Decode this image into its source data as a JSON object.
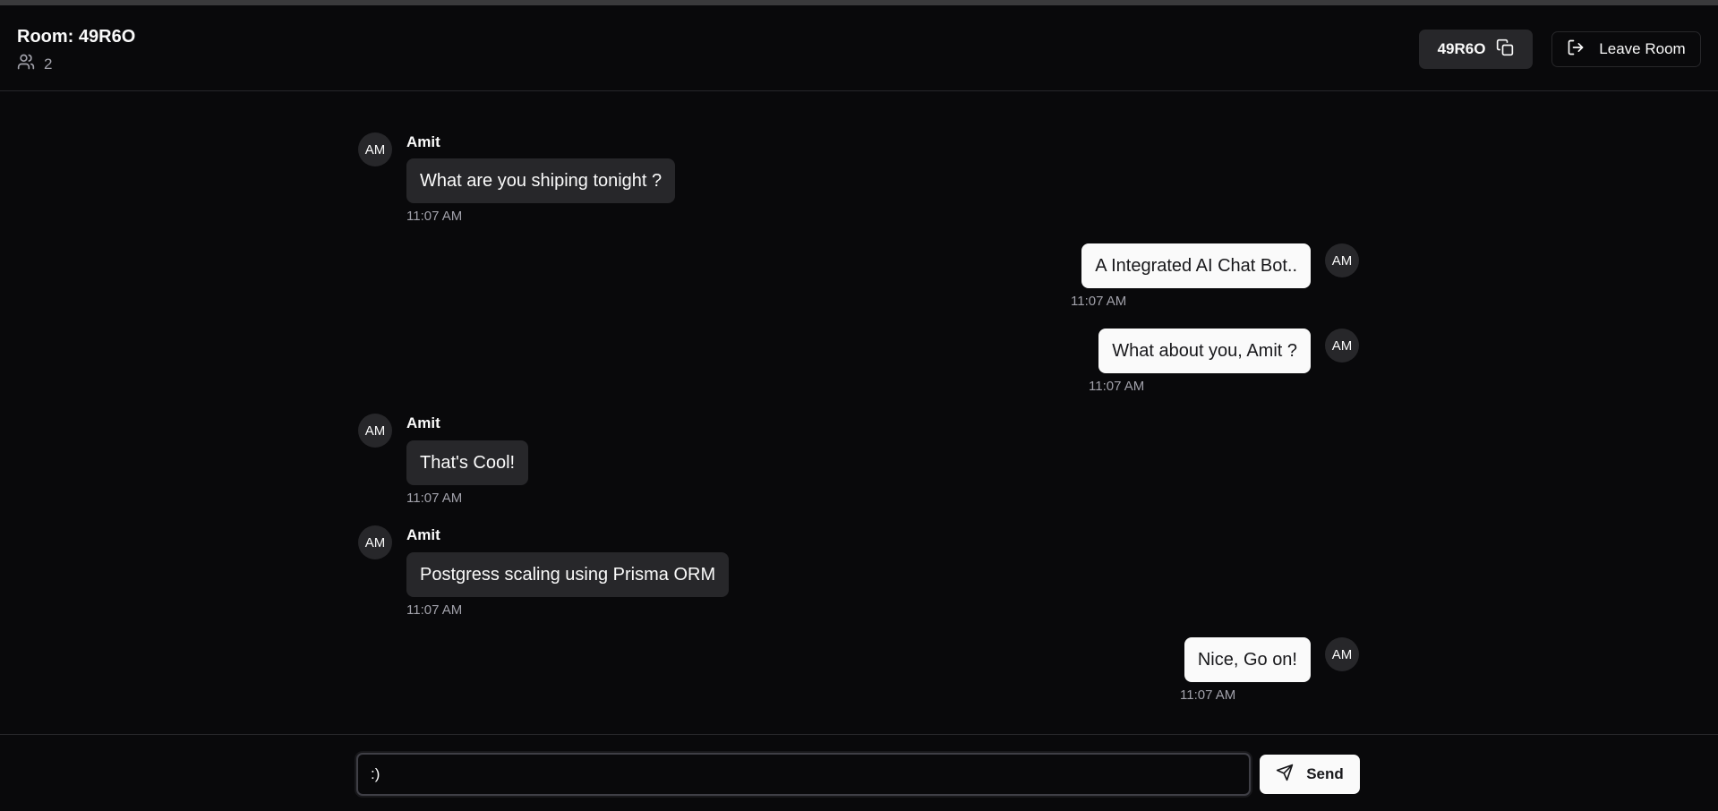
{
  "header": {
    "room_title": "Room: 49R6O",
    "member_count": "2",
    "room_code": "49R6O",
    "leave_label": "Leave Room"
  },
  "messages": [
    {
      "direction": "in",
      "sender": "Amit",
      "avatar": "AM",
      "text": "What are you shiping tonight ?",
      "time": "11:07 AM"
    },
    {
      "direction": "out",
      "avatar": "AM",
      "text": "A Integrated AI Chat Bot..",
      "time": "11:07 AM"
    },
    {
      "direction": "out",
      "avatar": "AM",
      "text": "What about you, Amit ?",
      "time": "11:07 AM"
    },
    {
      "direction": "in",
      "sender": "Amit",
      "avatar": "AM",
      "text": "That's Cool!",
      "time": "11:07 AM"
    },
    {
      "direction": "in",
      "sender": "Amit",
      "avatar": "AM",
      "text": "Postgress scaling using Prisma ORM",
      "time": "11:07 AM"
    },
    {
      "direction": "out",
      "avatar": "AM",
      "text": "Nice, Go on!",
      "time": "11:07 AM"
    }
  ],
  "composer": {
    "value": ":)",
    "send_label": "Send"
  },
  "icons": {
    "members": "users-icon",
    "copy": "copy-icon",
    "leave": "log-out-icon",
    "send": "send-icon"
  }
}
